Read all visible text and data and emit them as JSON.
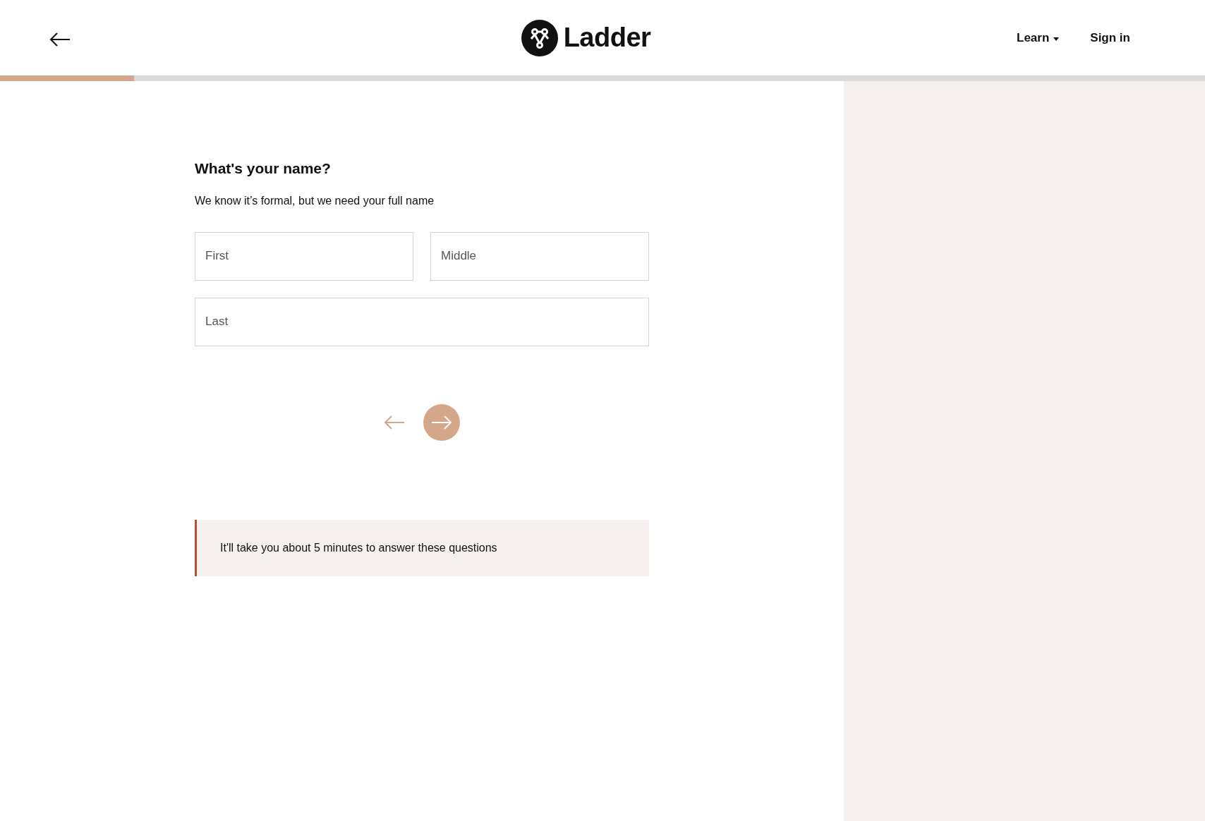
{
  "header": {
    "logo_text": "Ladder",
    "nav": [
      {
        "label": "Learn",
        "kind": "dropdown"
      },
      {
        "label": "Sign in",
        "kind": "link"
      }
    ]
  },
  "progress": {
    "level": 0.111
  },
  "form": {
    "title": "What's your name?",
    "subtitle": "We know it’s formal, but we need your full name",
    "fields": [
      {
        "placeholder": "First"
      },
      {
        "placeholder": "Middle"
      },
      {
        "placeholder": "Last"
      }
    ],
    "back_disabled": false
  },
  "info": {
    "text": "It'll take you about 5 minutes to answer these questions"
  }
}
